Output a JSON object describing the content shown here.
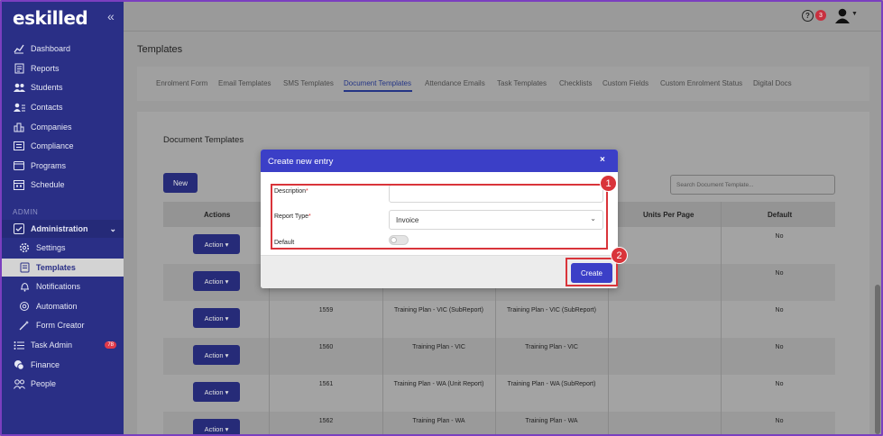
{
  "brand": {
    "logo": "eskilled",
    "collapse_icon": "«"
  },
  "sidebar": {
    "items": [
      {
        "label": "Dashboard",
        "icon": "chart-line-icon"
      },
      {
        "label": "Reports",
        "icon": "report-icon"
      },
      {
        "label": "Students",
        "icon": "students-icon"
      },
      {
        "label": "Contacts",
        "icon": "contacts-icon"
      },
      {
        "label": "Companies",
        "icon": "companies-icon"
      },
      {
        "label": "Compliance",
        "icon": "compliance-icon"
      },
      {
        "label": "Programs",
        "icon": "programs-icon"
      },
      {
        "label": "Schedule",
        "icon": "schedule-icon"
      }
    ],
    "section_label": "ADMIN",
    "admin_label": "Administration",
    "admin_sub": [
      {
        "label": "Settings",
        "icon": "gear-icon"
      },
      {
        "label": "Templates",
        "icon": "template-icon",
        "active": true
      },
      {
        "label": "Notifications",
        "icon": "bell-icon"
      },
      {
        "label": "Automation",
        "icon": "automation-icon"
      },
      {
        "label": "Form Creator",
        "icon": "wand-icon"
      }
    ],
    "task_admin": {
      "label": "Task Admin",
      "badge": "78"
    },
    "finance": "Finance",
    "people": "People"
  },
  "topbar": {
    "help_badge": "3"
  },
  "page": {
    "title": "Templates",
    "tabs": [
      "Enrolment Form",
      "Email Templates",
      "SMS Templates",
      "Document Templates",
      "Attendance Emails",
      "Task Templates",
      "Checklists",
      "Custom Fields",
      "Custom Enrolment Status",
      "Digital Docs"
    ],
    "active_tab": "Document Templates"
  },
  "card": {
    "title": "Document Templates",
    "new_label": "New",
    "search_placeholder": "Search Document Template...",
    "columns": [
      "Actions",
      "Units Per Page",
      "Default"
    ],
    "action_label": "Action",
    "rows": [
      {
        "id": "",
        "name": "",
        "filename": "",
        "default": "No"
      },
      {
        "id": "",
        "name": "",
        "filename": "",
        "default": "No"
      },
      {
        "id": "1559",
        "name": "Training Plan - VIC (SubReport)",
        "filename": "Training Plan - VIC (SubReport)",
        "default": "No"
      },
      {
        "id": "1560",
        "name": "Training Plan - VIC",
        "filename": "Training Plan - VIC",
        "default": "No"
      },
      {
        "id": "1561",
        "name": "Training Plan - WA (Unit Report)",
        "filename": "Training Plan - WA (SubReport)",
        "default": "No"
      },
      {
        "id": "1562",
        "name": "Training Plan - WA",
        "filename": "Training Plan - WA",
        "default": "No"
      }
    ]
  },
  "modal": {
    "title": "Create new entry",
    "close": "×",
    "description_label": "Description",
    "report_type_label": "Report Type",
    "report_type_value": "Invoice",
    "default_label": "Default",
    "required_mark": "*",
    "create_label": "Create"
  },
  "annotations": [
    "1",
    "2"
  ],
  "colors": {
    "accent": "#3b3fc7",
    "sidebar": "#2a2f86",
    "highlight": "#d9343a"
  }
}
